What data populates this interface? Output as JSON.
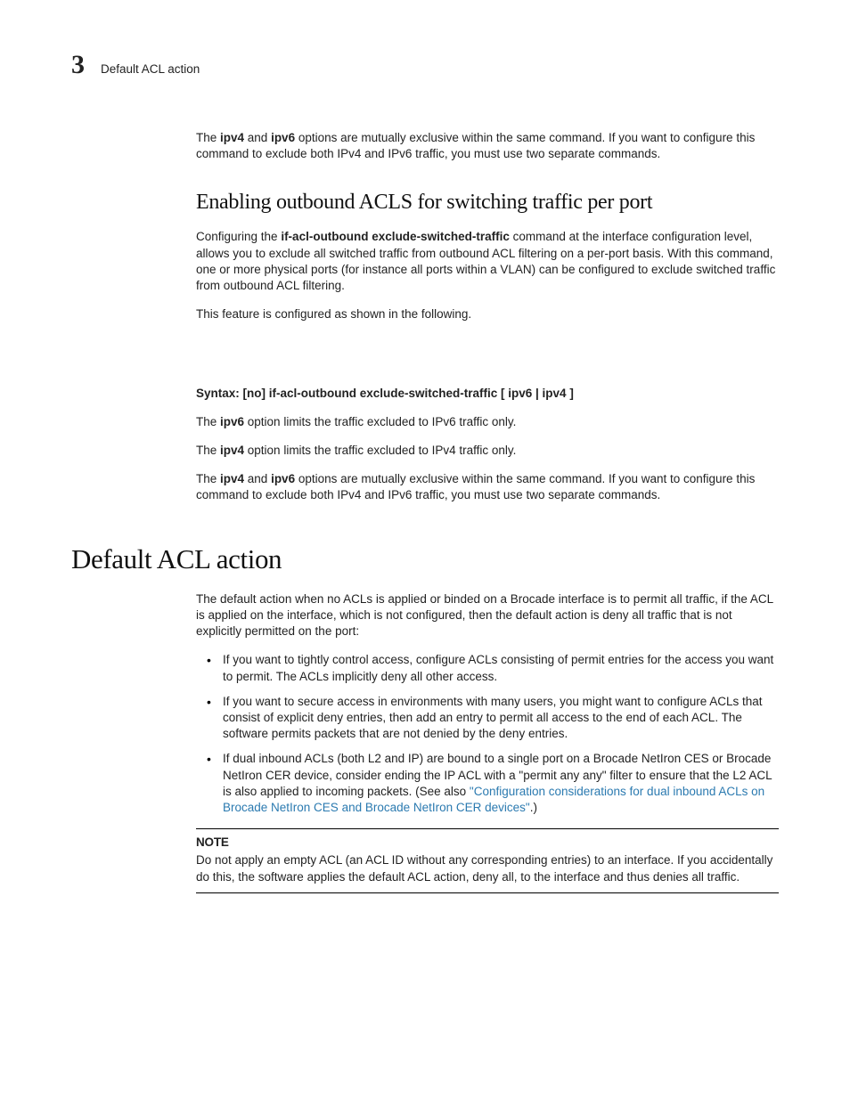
{
  "header": {
    "chapter_number": "3",
    "running_title": "Default ACL action"
  },
  "intro_para": {
    "pre1": "The ",
    "b1": "ipv4",
    "mid1": " and ",
    "b2": "ipv6",
    "post": " options are mutually exclusive within the same command. If you want to configure this command to exclude both IPv4 and IPv6 traffic, you must use two separate commands."
  },
  "section1": {
    "heading": "Enabling outbound ACLS for switching traffic per port",
    "p1_pre": "Configuring the ",
    "p1_bold": "if-acl-outbound exclude-switched-traffic",
    "p1_post": " command at the interface configuration level, allows you to exclude all switched traffic from outbound ACL filtering on a per-port basis. With this command, one or more physical ports (for instance all ports within a VLAN) can be configured to exclude switched traffic from outbound ACL filtering.",
    "p2": "This feature is configured as shown in the following.",
    "syntax": "Syntax:  [no] if-acl-outbound exclude-switched-traffic [ ipv6 | ipv4 ]",
    "p3_pre": "The ",
    "p3_bold": "ipv6",
    "p3_post": " option limits the traffic excluded to IPv6 traffic only.",
    "p4_pre": "The ",
    "p4_bold": "ipv4",
    "p4_post": " option limits the traffic excluded to IPv4 traffic only.",
    "p5_pre": "The ",
    "p5_b1": "ipv4",
    "p5_mid": " and ",
    "p5_b2": "ipv6",
    "p5_post": " options are mutually exclusive within the same command. If you want to configure this command to exclude both IPv4 and IPv6 traffic, you must use two separate commands."
  },
  "section2": {
    "heading": "Default ACL action",
    "p1": "The default action when no ACLs is applied or binded on a Brocade interface is to permit all traffic, if the ACL is applied on the interface, which is not configured, then the default action is deny all traffic that is not explicitly permitted on the port:",
    "bullets": [
      {
        "text": "If you want to tightly control access, configure ACLs consisting of permit entries for the access you want to permit. The ACLs implicitly deny all other access."
      },
      {
        "text": "If you want to secure access in environments with many users, you might want to configure ACLs that consist of explicit deny entries, then add an entry to permit all access to the end of each ACL. The software permits packets that are not denied by the deny entries."
      },
      {
        "pre": "If dual inbound ACLs (both L2 and IP) are bound to a single port on a Brocade NetIron CES or Brocade NetIron CER device, consider ending the IP ACL with a \"permit any any\" filter to ensure that the L2 ACL is also applied to incoming packets. (See also ",
        "link": "\"Configuration considerations for dual inbound ACLs on Brocade NetIron CES and Brocade NetIron CER devices\"",
        "post": ".)"
      }
    ],
    "note_head": "NOTE",
    "note_body": "Do not apply an empty ACL (an ACL ID without any corresponding entries) to an interface. If you accidentally do this, the software applies the default ACL action, deny all, to the interface and thus denies all traffic."
  }
}
